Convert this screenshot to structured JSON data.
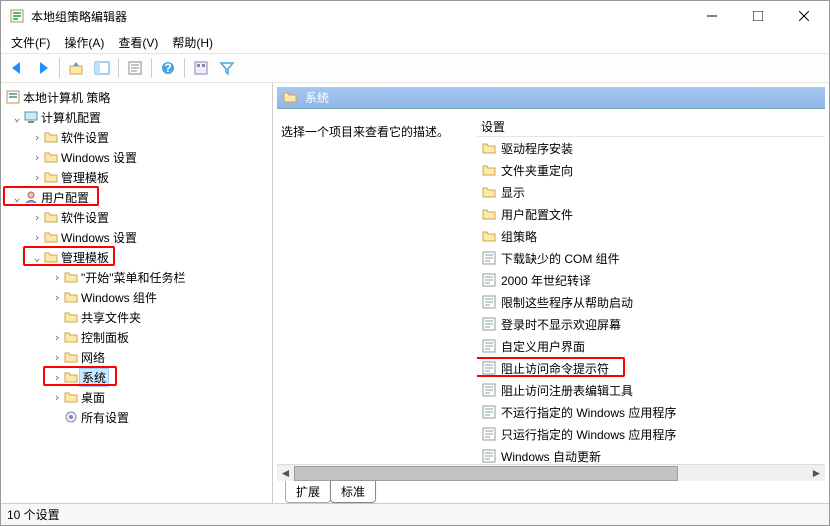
{
  "window": {
    "title": "本地组策略编辑器"
  },
  "menubar": {
    "file": "文件(F)",
    "action": "操作(A)",
    "view": "查看(V)",
    "help": "帮助(H)"
  },
  "tree": {
    "root": "本地计算机 策略",
    "computer": "计算机配置",
    "user": "用户配置",
    "software": "软件设置",
    "windows": "Windows 设置",
    "admin_tpl": "管理模板",
    "start_taskbar": "\"开始\"菜单和任务栏",
    "win_components": "Windows 组件",
    "shared_folders": "共享文件夹",
    "control_panel": "控制面板",
    "network": "网络",
    "system": "系统",
    "desktop": "桌面",
    "all_settings": "所有设置"
  },
  "right": {
    "header": "系统",
    "desc": "选择一个项目来查看它的描述。",
    "col_setting": "设置",
    "items": [
      {
        "type": "folder",
        "label": "驱动程序安装"
      },
      {
        "type": "folder",
        "label": "文件夹重定向"
      },
      {
        "type": "folder",
        "label": "显示"
      },
      {
        "type": "folder",
        "label": "用户配置文件"
      },
      {
        "type": "folder",
        "label": "组策略"
      },
      {
        "type": "setting",
        "label": "下载缺少的 COM 组件"
      },
      {
        "type": "setting",
        "label": "2000 年世纪转译"
      },
      {
        "type": "setting",
        "label": "限制这些程序从帮助启动"
      },
      {
        "type": "setting",
        "label": "登录时不显示欢迎屏幕"
      },
      {
        "type": "setting",
        "label": "自定义用户界面"
      },
      {
        "type": "setting",
        "label": "阻止访问命令提示符",
        "highlight": true
      },
      {
        "type": "setting",
        "label": "阻止访问注册表编辑工具"
      },
      {
        "type": "setting",
        "label": "不运行指定的 Windows 应用程序"
      },
      {
        "type": "setting",
        "label": "只运行指定的 Windows 应用程序"
      },
      {
        "type": "setting",
        "label": "Windows 自动更新"
      }
    ]
  },
  "tabs": {
    "extended": "扩展",
    "standard": "标准"
  },
  "status": {
    "count": "10 个设置"
  }
}
